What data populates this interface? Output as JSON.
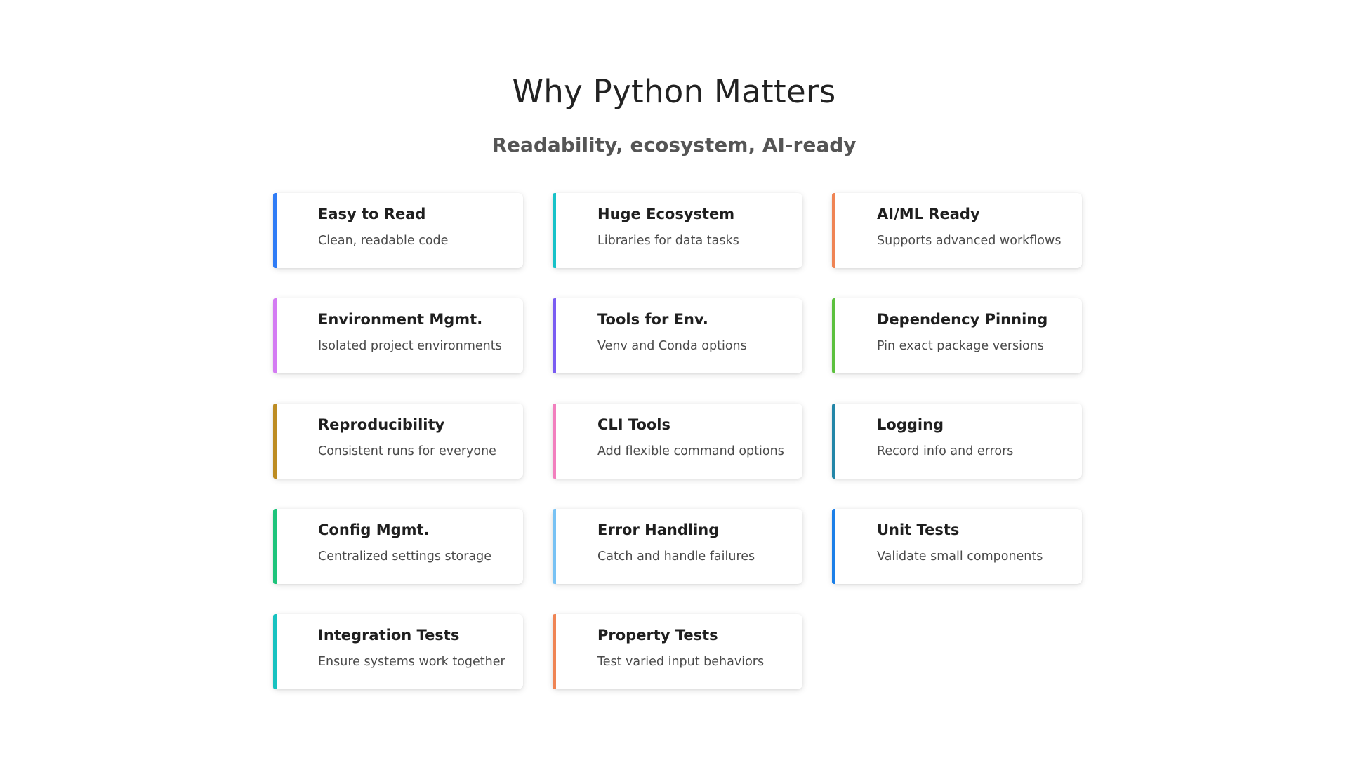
{
  "header": {
    "title": "Why Python Matters",
    "subtitle": "Readability, ecosystem, AI-ready"
  },
  "cards": [
    {
      "title": "Easy to Read",
      "desc": "Clean, readable code",
      "color": "#2f7cf6"
    },
    {
      "title": "Huge Ecosystem",
      "desc": "Libraries for data tasks",
      "color": "#17c2c8"
    },
    {
      "title": "AI/ML Ready",
      "desc": "Supports advanced workflows",
      "color": "#ef8454"
    },
    {
      "title": "Environment Mgmt.",
      "desc": "Isolated project environments",
      "color": "#d47cf3"
    },
    {
      "title": "Tools for Env.",
      "desc": "Venv and Conda options",
      "color": "#7a5cf2"
    },
    {
      "title": "Dependency Pinning",
      "desc": "Pin exact package versions",
      "color": "#5cc13e"
    },
    {
      "title": "Reproducibility",
      "desc": "Consistent runs for everyone",
      "color": "#bd8c22"
    },
    {
      "title": "CLI Tools",
      "desc": "Add flexible command options",
      "color": "#f27fbe"
    },
    {
      "title": "Logging",
      "desc": "Record info and errors",
      "color": "#2386a8"
    },
    {
      "title": "Config Mgmt.",
      "desc": "Centralized settings storage",
      "color": "#1ec47b"
    },
    {
      "title": "Error Handling",
      "desc": "Catch and handle failures",
      "color": "#78c2f4"
    },
    {
      "title": "Unit Tests",
      "desc": "Validate small components",
      "color": "#1b7fe8"
    },
    {
      "title": "Integration Tests",
      "desc": "Ensure systems work together",
      "color": "#17c2c0"
    },
    {
      "title": "Property Tests",
      "desc": "Test varied input behaviors",
      "color": "#ef8454"
    }
  ]
}
